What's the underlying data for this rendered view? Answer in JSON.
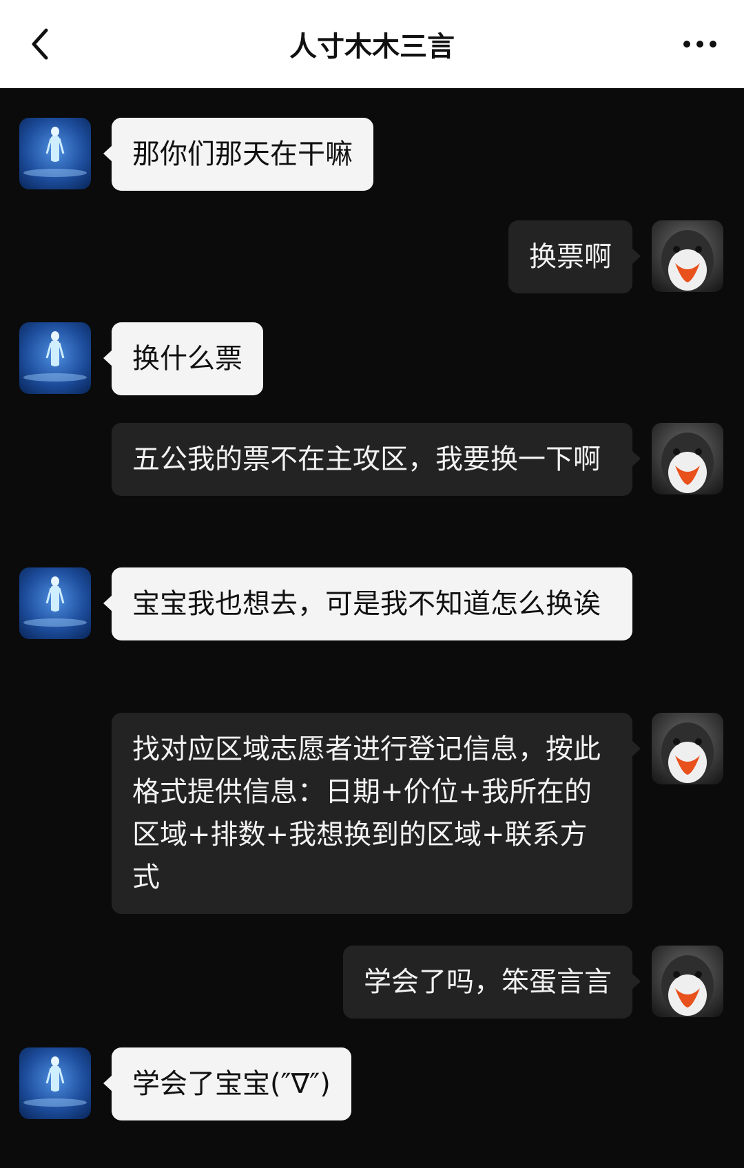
{
  "header": {
    "title": "人寸木木三言",
    "back_icon": "chevron-left-icon",
    "more_icon": "more-horizontal-icon"
  },
  "colors": {
    "header_bg": "#ffffff",
    "chat_bg": "#0b0b0b",
    "incoming_bubble": "#f4f4f4",
    "outgoing_bubble": "#232323"
  },
  "messages": [
    {
      "side": "incoming",
      "text": "那你们那天在干嘛"
    },
    {
      "side": "outgoing",
      "text": "换票啊"
    },
    {
      "side": "incoming",
      "text": "换什么票"
    },
    {
      "side": "outgoing",
      "text": "五公我的票不在主攻区，我要换一下啊"
    },
    {
      "side": "incoming",
      "text": "宝宝我也想去，可是我不知道怎么换诶"
    },
    {
      "side": "outgoing",
      "text": "找对应区域志愿者进行登记信息，按此格式提供信息：日期+价位+我所在的区域+排数+我想换到的区域+联系方式"
    },
    {
      "side": "outgoing",
      "text": "学会了吗，笨蛋言言"
    },
    {
      "side": "incoming",
      "text": "学会了宝宝(″∇″)"
    }
  ]
}
